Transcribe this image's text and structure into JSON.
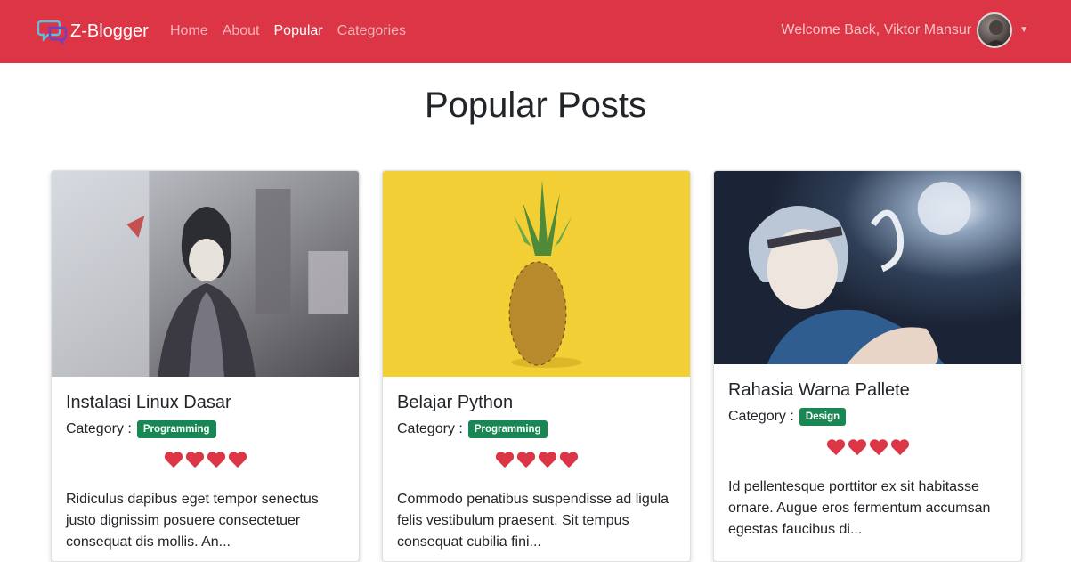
{
  "navbar": {
    "brand": "Z-Blogger",
    "links": [
      {
        "label": "Home",
        "active": false
      },
      {
        "label": "About",
        "active": false
      },
      {
        "label": "Popular",
        "active": true
      },
      {
        "label": "Categories",
        "active": false
      }
    ],
    "welcome": "Welcome Back, Viktor Mansur",
    "colors": {
      "bg": "#dc3545"
    }
  },
  "page": {
    "title": "Popular Posts"
  },
  "posts": [
    {
      "title": "Instalasi Linux Dasar",
      "category_label": "Category :",
      "category": "Programming",
      "rating": 4,
      "excerpt": "Ridiculus dapibus eget tempor senectus justo dignissim posuere consectetuer consequat dis mollis. An...",
      "image_icon": "anime-character-image"
    },
    {
      "title": "Belajar Python",
      "category_label": "Category :",
      "category": "Programming",
      "rating": 4,
      "excerpt": "Commodo penatibus suspendisse ad ligula felis vestibulum praesent. Sit tempus consequat cubilia fini...",
      "image_icon": "pineapple-image"
    },
    {
      "title": "Rahasia Warna Pallete",
      "category_label": "Category :",
      "category": "Design",
      "rating": 4,
      "excerpt": "Id pellentesque porttitor ex sit habitasse ornare. Augue eros fermentum accumsan egestas faucibus di...",
      "image_icon": "anime-moon-image"
    }
  ],
  "colors": {
    "heart": "#dc3545",
    "badge": "#198754"
  }
}
